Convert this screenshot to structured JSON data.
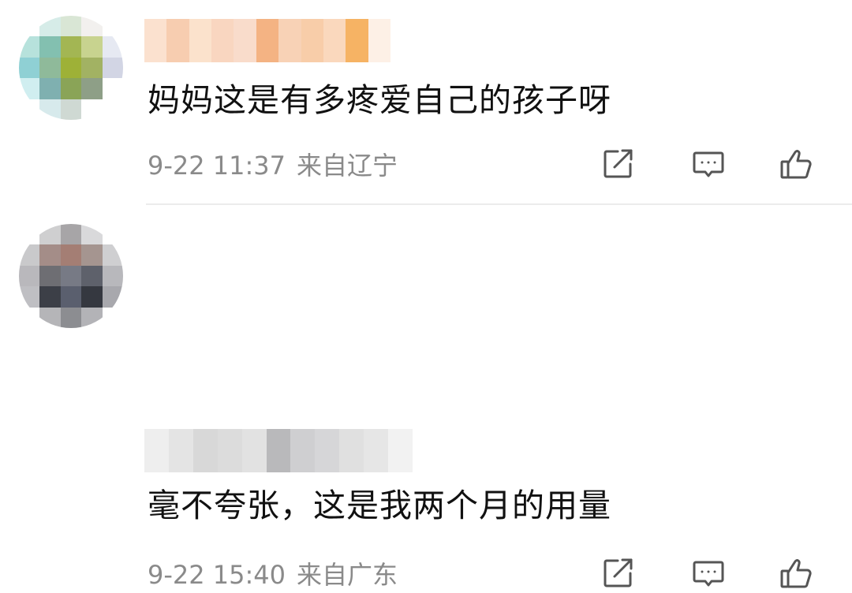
{
  "comments": [
    {
      "text": "妈妈这是有多疼爱自己的孩子呀",
      "date": "9-22 11:37",
      "location": "来自辽宁",
      "avatar_colors": [
        "#ffffff",
        "#d6ece8",
        "#d9e6d5",
        "#f2f0ee",
        "#ffffff",
        "#b7e2dc",
        "#83c0b0",
        "#a3b653",
        "#c8d38f",
        "#e6e9f2",
        "#8fd0d4",
        "#8fba9a",
        "#9eb137",
        "#a2b263",
        "#d2d5e4",
        "#d0eef0",
        "#7fb0b0",
        "#8aa457",
        "#8e9f87",
        "#ffffff",
        "#ffffff",
        "#d7eaec",
        "#cfd9d3",
        "#ffffff",
        "#ffffff"
      ],
      "username_colors": [
        "#fbe1cf",
        "#f7cdb0",
        "#fbe2cc",
        "#f9d6c0",
        "#f9dccb",
        "#f4b383",
        "#f8d2b6",
        "#f8cda9",
        "#fad8bd",
        "#f6b364",
        "#fdf0e6"
      ],
      "icons": {
        "share": "share-square-icon",
        "reply": "comment-bubble-icon",
        "like": "thumbs-up-icon"
      }
    },
    {
      "text": "毫不夸张，这是我两个月的用量",
      "date": "9-22 15:40",
      "location": "来自广东",
      "avatar_colors": [
        "#ffffff",
        "#cfcfd0",
        "#a7a5a7",
        "#d9d9db",
        "#ffffff",
        "#c9c9cb",
        "#a48d88",
        "#a47e74",
        "#a59590",
        "#cfcfd1",
        "#b9b8bc",
        "#6e6e73",
        "#777a85",
        "#5e616b",
        "#b8b8bc",
        "#bfbfc3",
        "#3c3f47",
        "#5a5f6e",
        "#353840",
        "#a8a8ad",
        "#ffffff",
        "#b5b5b8",
        "#8c8d91",
        "#b3b3b7",
        "#ffffff"
      ],
      "username_colors": [
        "#eeeeee",
        "#e4e4e4",
        "#d8d8d8",
        "#dcdcdc",
        "#e2e2e2",
        "#b9b9bb",
        "#cfcfd1",
        "#d6d6d8",
        "#e0e0e0",
        "#e6e6e6",
        "#f2f2f2"
      ],
      "icons": {
        "share": "share-square-icon",
        "reply": "comment-bubble-icon",
        "like": "thumbs-up-icon"
      }
    }
  ],
  "theme": {
    "text_color": "#111111",
    "meta_color": "#8a8a8a",
    "icon_color": "#555555",
    "divider_color": "#ececec"
  }
}
